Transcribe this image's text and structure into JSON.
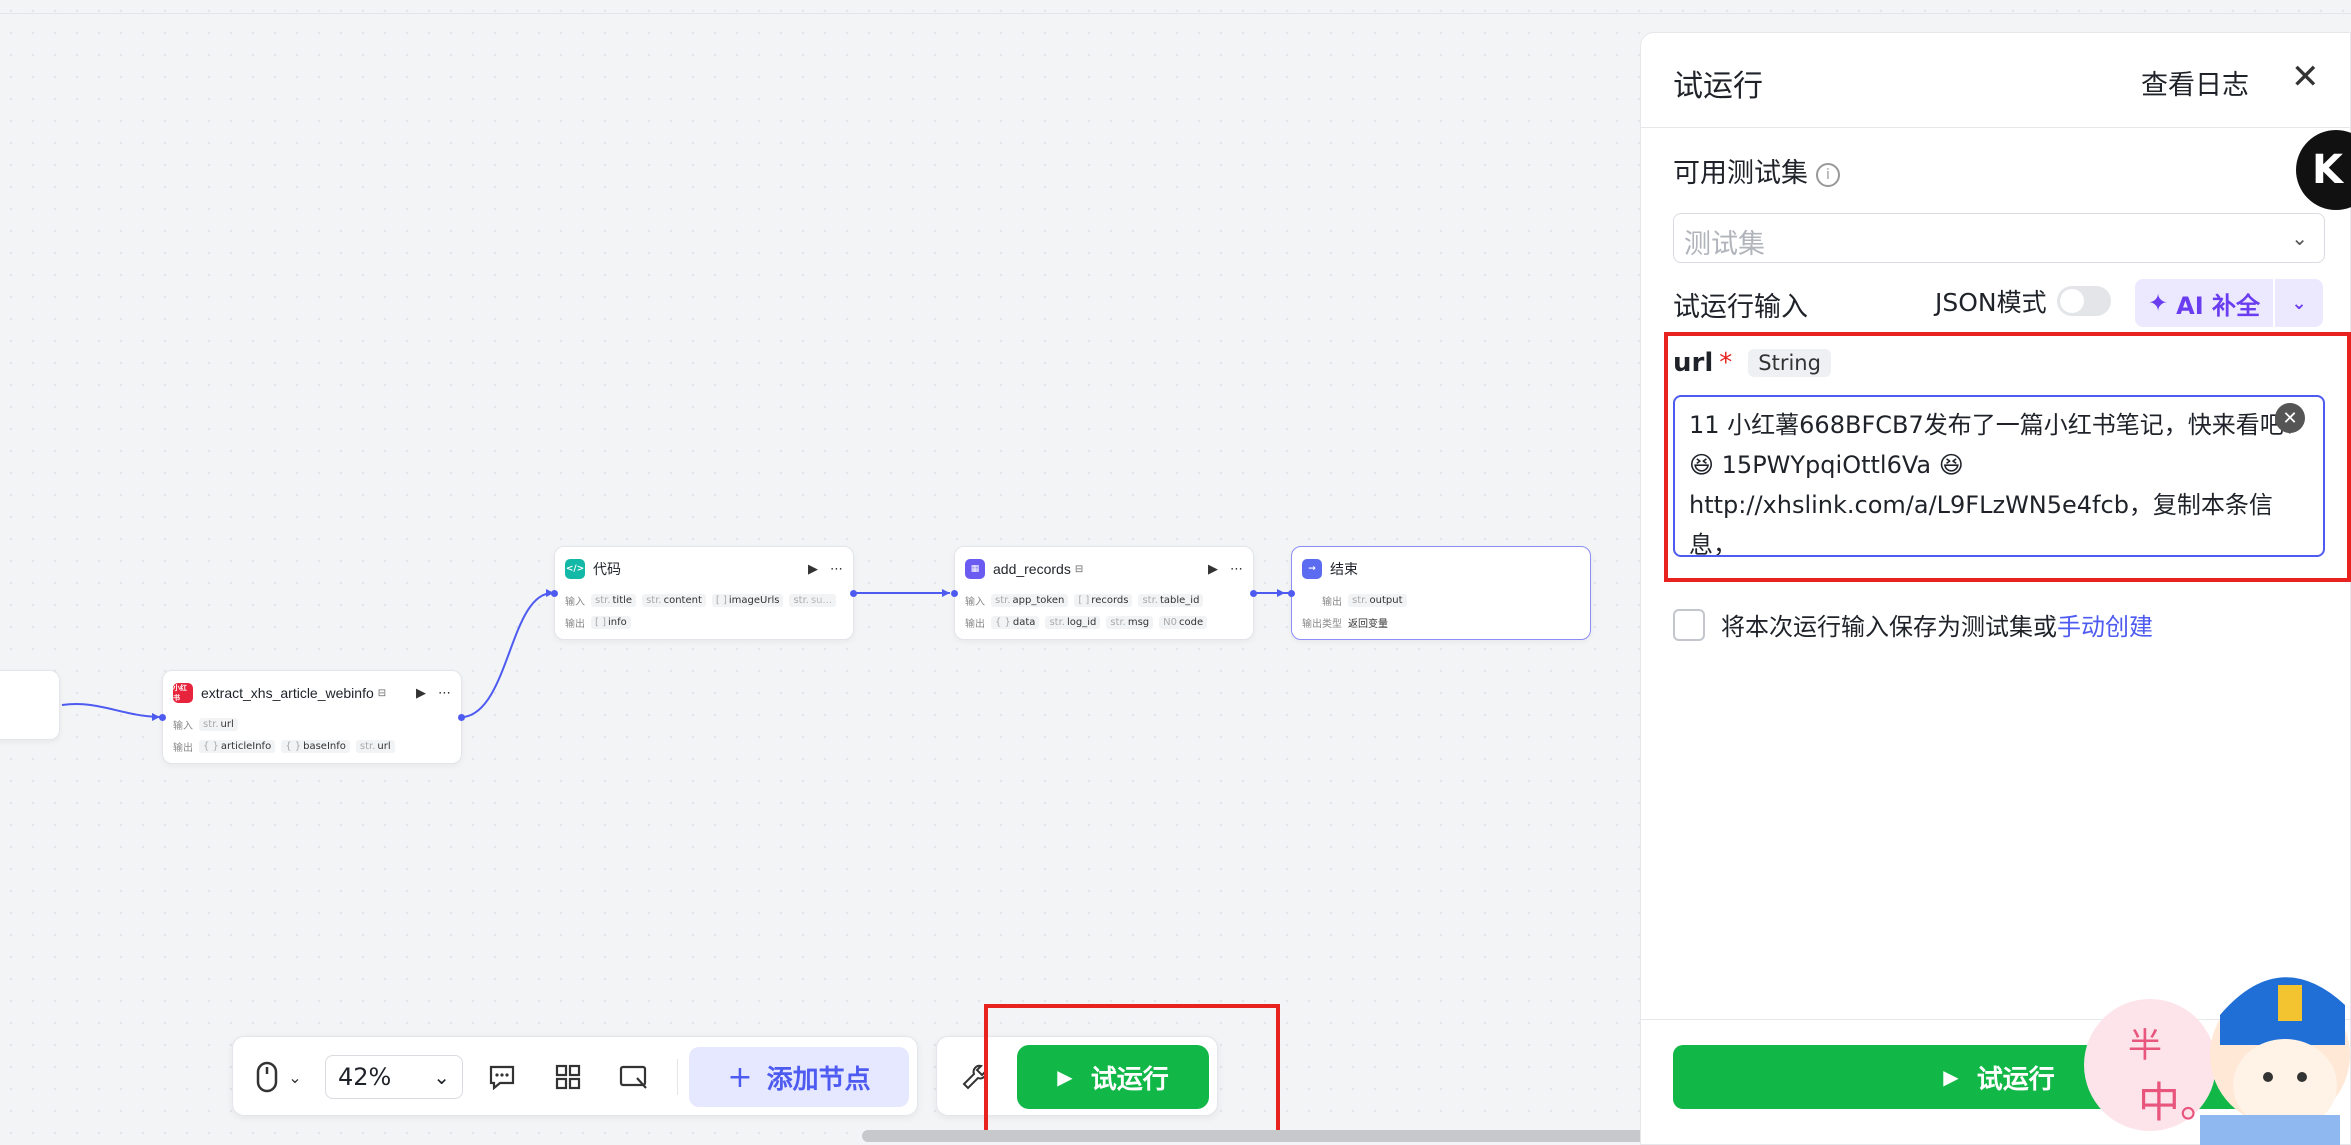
{
  "canvas": {
    "nodes": {
      "extract": {
        "title": "extract_xhs_article_webinfo",
        "icon_text": "小红书",
        "in_label": "输入",
        "out_label": "输出",
        "inputs": [
          {
            "type": "str.",
            "name": "url"
          }
        ],
        "outputs": [
          {
            "type": "{ }",
            "name": "articleInfo"
          },
          {
            "type": "{ }",
            "name": "baseInfo"
          },
          {
            "type": "str.",
            "name": "url"
          }
        ]
      },
      "code": {
        "title": "代码",
        "icon_text": "</>",
        "in_label": "输入",
        "out_label": "输出",
        "inputs": [
          {
            "type": "str.",
            "name": "title"
          },
          {
            "type": "str.",
            "name": "content"
          },
          {
            "type": "[ ]",
            "name": "imageUrls"
          },
          {
            "type": "str.",
            "name": "su..."
          }
        ],
        "outputs": [
          {
            "type": "[ ]",
            "name": "info"
          }
        ]
      },
      "add_records": {
        "title": "add_records",
        "icon_text": "▦",
        "in_label": "输入",
        "out_label": "输出",
        "inputs": [
          {
            "type": "str.",
            "name": "app_token"
          },
          {
            "type": "[ ]",
            "name": "records"
          },
          {
            "type": "str.",
            "name": "table_id"
          }
        ],
        "outputs": [
          {
            "type": "{ }",
            "name": "data"
          },
          {
            "type": "str.",
            "name": "log_id"
          },
          {
            "type": "str.",
            "name": "msg"
          },
          {
            "type": "N0",
            "name": "code"
          }
        ]
      },
      "end": {
        "title": "结束",
        "icon_text": "→",
        "out_label": "输出",
        "outputs": [
          {
            "type": "str.",
            "name": "output"
          }
        ],
        "out_type_label": "输出类型",
        "out_type_value": "返回变量"
      }
    }
  },
  "toolbar": {
    "zoom": "42%",
    "add_node": "添加节点",
    "run": "试运行"
  },
  "panel": {
    "title": "试运行",
    "view_log": "查看日志",
    "test_set_label": "可用测试集",
    "test_set_placeholder": "测试集",
    "input_label": "试运行输入",
    "json_mode": "JSON模式",
    "ai_fill": "AI 补全",
    "field_name": "url",
    "field_required": "*",
    "field_type": "String",
    "field_value": "11 小红薯668BFCB7发布了一篇小红书笔记，快来看吧！\n😆 15PWYpqiOttl6Va 😆\nhttp://xhslink.com/a/L9FLzWN5e4fcb，复制本条信息，\n打开【小红书】App查看精彩内容！",
    "save_text": "将本次运行输入保存为测试集或",
    "save_link": "手动创建",
    "run_button": "试运行"
  },
  "sticker": {
    "text_top": "半",
    "text_bottom": "中。"
  },
  "floating_badge": "K",
  "colors": {
    "accent": "#4e5bf0",
    "run_green": "#12b847",
    "highlight_red": "#e8231f",
    "ai_purple": "#6a3df0"
  }
}
